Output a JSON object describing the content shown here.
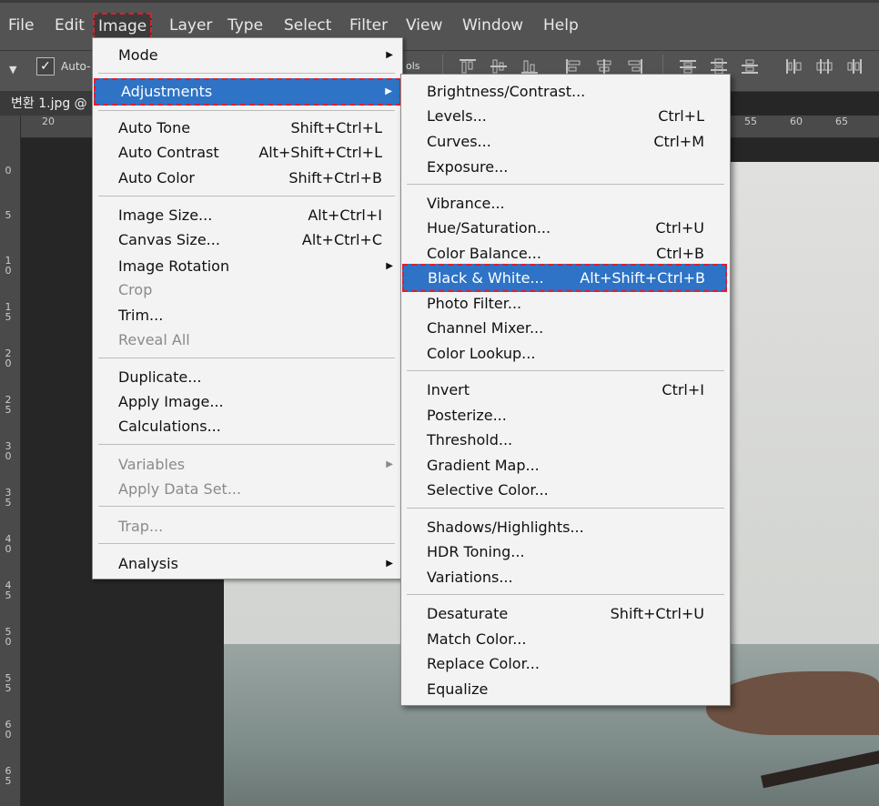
{
  "menubar": {
    "items": [
      "File",
      "Edit",
      "Image",
      "Layer",
      "Type",
      "Select",
      "Filter",
      "View",
      "Window",
      "Help"
    ],
    "active": "Image"
  },
  "options_bar": {
    "auto_label": "Auto-",
    "cut_text": "ols"
  },
  "document": {
    "tab_title": "변환 1.jpg @"
  },
  "ruler": {
    "h_ticks": [
      "20",
      "55",
      "60",
      "65"
    ],
    "v_ticks": [
      "0",
      "5",
      "1 0",
      "1 5",
      "2 0",
      "2 5",
      "3 0",
      "3 5",
      "4 0",
      "4 5",
      "5 0",
      "5 5",
      "6 0",
      "6 5"
    ]
  },
  "image_menu": {
    "items": [
      {
        "label": "Mode",
        "shortcut": "",
        "submenu": true,
        "disabled": false
      },
      {
        "label": "Adjustments",
        "shortcut": "",
        "submenu": true,
        "disabled": false,
        "highlighted": true
      },
      {
        "label": "Auto Tone",
        "shortcut": "Shift+Ctrl+L",
        "submenu": false,
        "disabled": false
      },
      {
        "label": "Auto Contrast",
        "shortcut": "Alt+Shift+Ctrl+L",
        "submenu": false,
        "disabled": false
      },
      {
        "label": "Auto Color",
        "shortcut": "Shift+Ctrl+B",
        "submenu": false,
        "disabled": false
      },
      {
        "label": "Image Size...",
        "shortcut": "Alt+Ctrl+I",
        "submenu": false,
        "disabled": false
      },
      {
        "label": "Canvas Size...",
        "shortcut": "Alt+Ctrl+C",
        "submenu": false,
        "disabled": false
      },
      {
        "label": "Image Rotation",
        "shortcut": "",
        "submenu": true,
        "disabled": false
      },
      {
        "label": "Crop",
        "shortcut": "",
        "submenu": false,
        "disabled": true
      },
      {
        "label": "Trim...",
        "shortcut": "",
        "submenu": false,
        "disabled": false
      },
      {
        "label": "Reveal All",
        "shortcut": "",
        "submenu": false,
        "disabled": true
      },
      {
        "label": "Duplicate...",
        "shortcut": "",
        "submenu": false,
        "disabled": false
      },
      {
        "label": "Apply Image...",
        "shortcut": "",
        "submenu": false,
        "disabled": false
      },
      {
        "label": "Calculations...",
        "shortcut": "",
        "submenu": false,
        "disabled": false
      },
      {
        "label": "Variables",
        "shortcut": "",
        "submenu": true,
        "disabled": true
      },
      {
        "label": "Apply Data Set...",
        "shortcut": "",
        "submenu": false,
        "disabled": true
      },
      {
        "label": "Trap...",
        "shortcut": "",
        "submenu": false,
        "disabled": true
      },
      {
        "label": "Analysis",
        "shortcut": "",
        "submenu": true,
        "disabled": false
      }
    ]
  },
  "adjustments_menu": {
    "items": [
      {
        "label": "Brightness/Contrast...",
        "shortcut": ""
      },
      {
        "label": "Levels...",
        "shortcut": "Ctrl+L"
      },
      {
        "label": "Curves...",
        "shortcut": "Ctrl+M"
      },
      {
        "label": "Exposure...",
        "shortcut": ""
      },
      {
        "label": "Vibrance...",
        "shortcut": ""
      },
      {
        "label": "Hue/Saturation...",
        "shortcut": "Ctrl+U"
      },
      {
        "label": "Color Balance...",
        "shortcut": "Ctrl+B"
      },
      {
        "label": "Black & White...",
        "shortcut": "Alt+Shift+Ctrl+B",
        "highlighted": true
      },
      {
        "label": "Photo Filter...",
        "shortcut": ""
      },
      {
        "label": "Channel Mixer...",
        "shortcut": ""
      },
      {
        "label": "Color Lookup...",
        "shortcut": ""
      },
      {
        "label": "Invert",
        "shortcut": "Ctrl+I"
      },
      {
        "label": "Posterize...",
        "shortcut": ""
      },
      {
        "label": "Threshold...",
        "shortcut": ""
      },
      {
        "label": "Gradient Map...",
        "shortcut": ""
      },
      {
        "label": "Selective Color...",
        "shortcut": ""
      },
      {
        "label": "Shadows/Highlights...",
        "shortcut": ""
      },
      {
        "label": "HDR Toning...",
        "shortcut": ""
      },
      {
        "label": "Variations...",
        "shortcut": ""
      },
      {
        "label": "Desaturate",
        "shortcut": "Shift+Ctrl+U"
      },
      {
        "label": "Match Color...",
        "shortcut": ""
      },
      {
        "label": "Replace Color...",
        "shortcut": ""
      },
      {
        "label": "Equalize",
        "shortcut": ""
      }
    ]
  },
  "colors": {
    "highlight": "#2e73c5",
    "annotation": "#e21d2b",
    "menu_bg": "#f3f3f3",
    "chrome": "#535353"
  }
}
